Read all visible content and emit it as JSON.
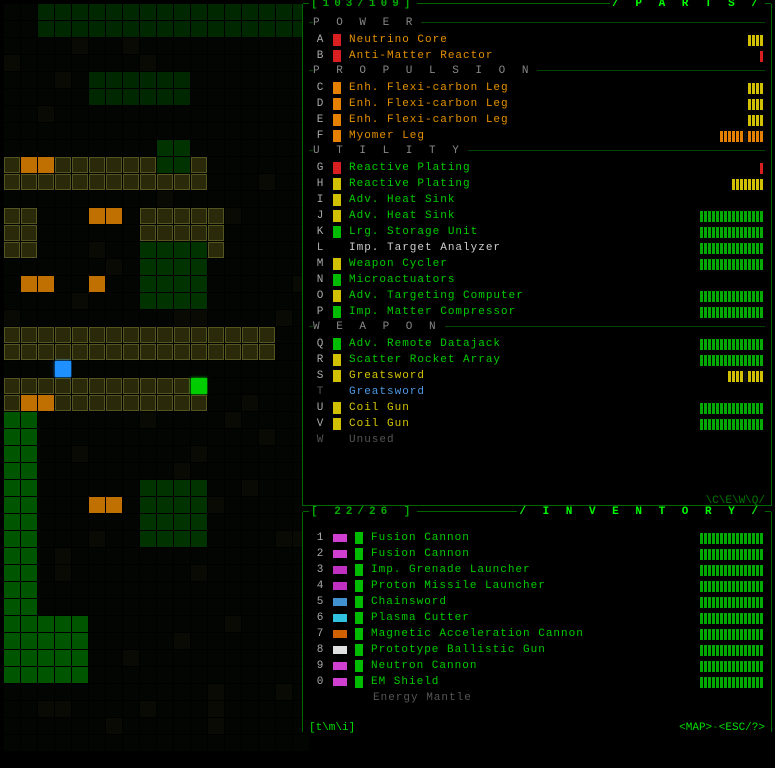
{
  "parts": {
    "header_count": "[103/109]",
    "title": "/ P A R T S /",
    "footer": "\\C\\E\\W\\Q/",
    "sections": [
      {
        "label": "P O W E R",
        "items": [
          {
            "key": "A",
            "swatch": "sw-red",
            "name": "Neutrino Core",
            "color": "c-orange",
            "bars": "||||",
            "bcolor": "b-ye"
          },
          {
            "key": "B",
            "swatch": "sw-red",
            "name": "Anti-Matter Reactor",
            "color": "c-orange",
            "bars": "|",
            "bcolor": "b-rd"
          }
        ]
      },
      {
        "label": "P R O P U L S I O N",
        "items": [
          {
            "key": "C",
            "swatch": "sw-orange",
            "name": "Enh. Flexi-carbon Leg",
            "color": "c-orange",
            "bars": "||||",
            "bcolor": "b-ye"
          },
          {
            "key": "D",
            "swatch": "sw-orange",
            "name": "Enh. Flexi-carbon Leg",
            "color": "c-orange",
            "bars": "||||",
            "bcolor": "b-ye"
          },
          {
            "key": "E",
            "swatch": "sw-orange",
            "name": "Enh. Flexi-carbon Leg",
            "color": "c-orange",
            "bars": "||||",
            "bcolor": "b-ye"
          },
          {
            "key": "F",
            "swatch": "sw-orange",
            "name": "Myomer Leg",
            "color": "c-orange",
            "bars": "|||||| ||||",
            "bcolor": "b-or"
          }
        ]
      },
      {
        "label": "U T I L I T Y",
        "items": [
          {
            "key": "G",
            "swatch": "sw-red",
            "name": "Reactive Plating",
            "color": "c-green",
            "bars": "|",
            "bcolor": "b-rd"
          },
          {
            "key": "H",
            "swatch": "sw-yellow",
            "name": "Reactive Plating",
            "color": "c-green",
            "bars": "||||||||",
            "bcolor": "b-ye"
          },
          {
            "key": "I",
            "swatch": "sw-yellow",
            "name": "Adv. Heat Sink",
            "color": "c-green",
            "bars": "",
            "bcolor": "b-gr"
          },
          {
            "key": "J",
            "swatch": "sw-yellow",
            "name": "Adv. Heat Sink",
            "color": "c-green",
            "bars": "||||||||||||||||",
            "bcolor": "b-gr"
          },
          {
            "key": "K",
            "swatch": "sw-green",
            "name": "Lrg. Storage Unit",
            "color": "c-green",
            "bars": "||||||||||||||||",
            "bcolor": "b-gr"
          },
          {
            "key": "L",
            "swatch": "sw-none",
            "name": "Imp. Target Analyzer",
            "color": "c-white",
            "bars": "||||||||||||||||",
            "bcolor": "b-gr"
          },
          {
            "key": "M",
            "swatch": "sw-yellow",
            "name": "Weapon Cycler",
            "color": "c-green",
            "bars": "||||||||||||||||",
            "bcolor": "b-gr"
          },
          {
            "key": "N",
            "swatch": "sw-green",
            "name": "Microactuators",
            "color": "c-green",
            "bars": "",
            "bcolor": "b-gr"
          },
          {
            "key": "O",
            "swatch": "sw-yellow",
            "name": "Adv. Targeting Computer",
            "color": "c-green",
            "bars": "||||||||||||||||",
            "bcolor": "b-gr"
          },
          {
            "key": "P",
            "swatch": "sw-green",
            "name": "Imp. Matter Compressor",
            "color": "c-green",
            "bars": "||||||||||||||||",
            "bcolor": "b-gr"
          }
        ]
      },
      {
        "label": "W E A P O N",
        "items": [
          {
            "key": "Q",
            "swatch": "sw-green",
            "name": "Adv. Remote Datajack",
            "color": "c-green",
            "bars": "||||||||||||||||",
            "bcolor": "b-gr"
          },
          {
            "key": "R",
            "swatch": "sw-yellow",
            "name": "Scatter Rocket Array",
            "color": "c-green",
            "bars": "||||||||||||||||",
            "bcolor": "b-gr"
          },
          {
            "key": "S",
            "swatch": "sw-yellow",
            "name": "Greatsword",
            "color": "c-yellow",
            "bars": "|||| ||||",
            "bcolor": "b-ye"
          },
          {
            "key": "T",
            "swatch": "sw-none",
            "name": "Greatsword",
            "color": "c-blue",
            "bars": "",
            "bcolor": "b-gr",
            "dimkey": true
          },
          {
            "key": "U",
            "swatch": "sw-yellow",
            "name": "Coil Gun",
            "color": "c-yellow",
            "bars": "||||||||||||||||",
            "bcolor": "b-gr"
          },
          {
            "key": "V",
            "swatch": "sw-yellow",
            "name": "Coil Gun",
            "color": "c-yellow",
            "bars": "||||||||||||||||",
            "bcolor": "b-gr"
          },
          {
            "key": "W",
            "swatch": "sw-none",
            "name": "Unused",
            "color": "c-dim",
            "bars": "",
            "bcolor": "b-dim",
            "dimkey": true
          }
        ]
      }
    ]
  },
  "inventory": {
    "header_count": "[ 22/26 ]",
    "title": "/ I N V E N T O R Y /",
    "footer_left": "[t\\m\\i]",
    "footer_right": "<MAP>-<ESC/?>",
    "items": [
      {
        "key": "1",
        "icon": "#d040d0",
        "swatch": "sw-green",
        "name": "Fusion Cannon",
        "color": "c-green",
        "bars": "||||||||||||||||",
        "bcolor": "b-gr"
      },
      {
        "key": "2",
        "icon": "#d040d0",
        "swatch": "sw-green",
        "name": "Fusion Cannon",
        "color": "c-green",
        "bars": "||||||||||||||||",
        "bcolor": "b-gr"
      },
      {
        "key": "3",
        "icon": "#c030c0",
        "swatch": "sw-green",
        "name": "Imp. Grenade Launcher",
        "color": "c-green",
        "bars": "||||||||||||||||",
        "bcolor": "b-gr"
      },
      {
        "key": "4",
        "icon": "#c030c0",
        "swatch": "sw-green",
        "name": "Proton Missile Launcher",
        "color": "c-green",
        "bars": "||||||||||||||||",
        "bcolor": "b-gr"
      },
      {
        "key": "5",
        "icon": "#4090d0",
        "swatch": "sw-green",
        "name": "Chainsword",
        "color": "c-green",
        "bars": "||||||||||||||||",
        "bcolor": "b-gr"
      },
      {
        "key": "6",
        "icon": "#30c0e0",
        "swatch": "sw-green",
        "name": "Plasma Cutter",
        "color": "c-green",
        "bars": "||||||||||||||||",
        "bcolor": "b-gr"
      },
      {
        "key": "7",
        "icon": "#d06000",
        "swatch": "sw-green",
        "name": "Magnetic Acceleration Cannon",
        "color": "c-green",
        "bars": "||||||||||||||||",
        "bcolor": "b-gr"
      },
      {
        "key": "8",
        "icon": "#e0e0e0",
        "swatch": "sw-green",
        "name": "Prototype Ballistic Gun",
        "color": "c-green",
        "bars": "||||||||||||||||",
        "bcolor": "b-gr"
      },
      {
        "key": "9",
        "icon": "#d040d0",
        "swatch": "sw-green",
        "name": "Neutron Cannon",
        "color": "c-green",
        "bars": "||||||||||||||||",
        "bcolor": "b-gr"
      },
      {
        "key": "0",
        "icon": "#d040d0",
        "swatch": "sw-green",
        "name": "EM Shield",
        "color": "c-green",
        "bars": "||||||||||||||||",
        "bcolor": "b-gr"
      },
      {
        "key": "",
        "icon": "",
        "swatch": "sw-none",
        "name": "Energy Mantle",
        "color": "c-dim",
        "bars": "",
        "bcolor": "b-dim"
      }
    ]
  },
  "map_sample": "cogmind-tilemap"
}
